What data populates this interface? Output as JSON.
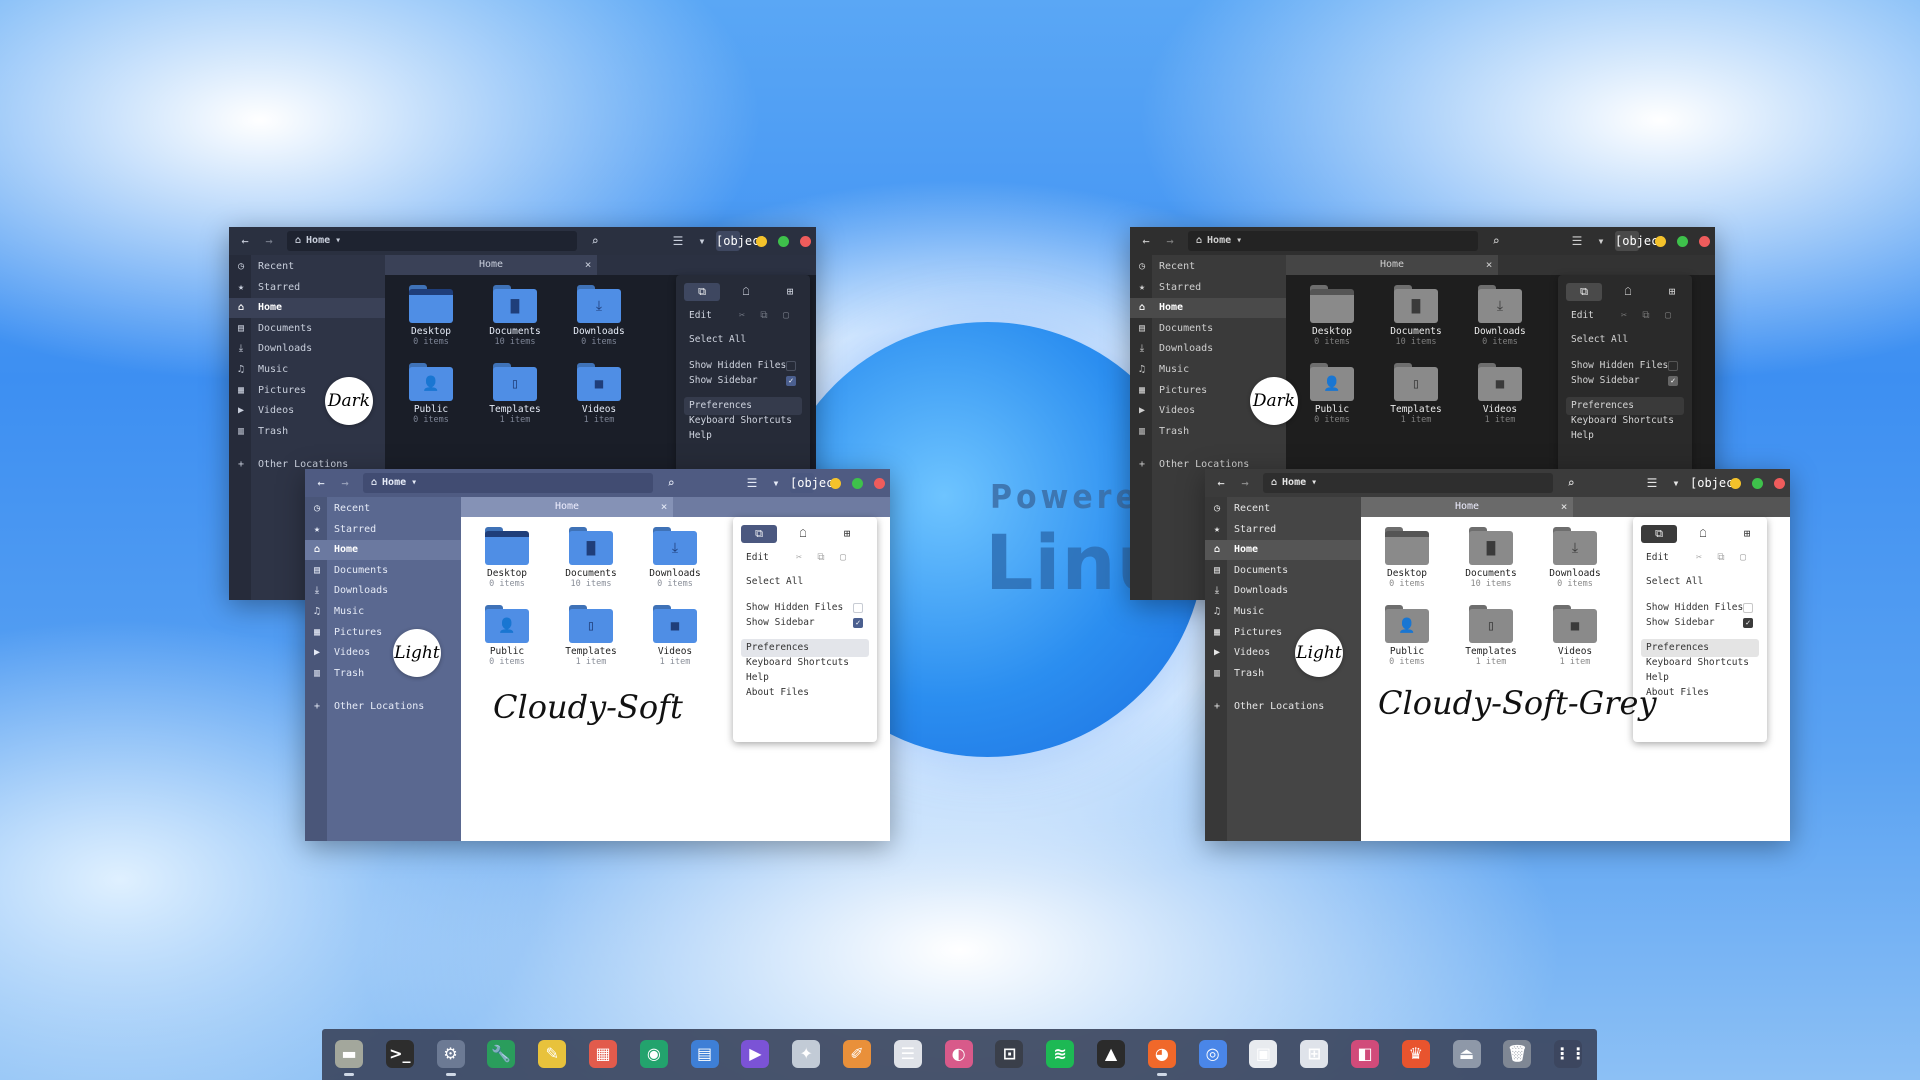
{
  "common": {
    "back": "←",
    "forward": "→",
    "home_icon": "⌂",
    "path": "Home",
    "caret": "▾",
    "search": "⌕",
    "view": "☰",
    "menu": {
      "top_icons": [
        "⧉",
        "☖",
        "⊞"
      ],
      "edit": "Edit",
      "cut": "✂",
      "copy": "⧉",
      "paste": "▢",
      "select_all": "Select All",
      "show_hidden": "Show Hidden Files",
      "show_sidebar": "Show Sidebar",
      "check": "✓",
      "preferences": "Preferences",
      "shortcuts": "Keyboard Shortcuts",
      "help": "Help",
      "about": "About Files"
    },
    "tab": "Home",
    "tab_close": "×",
    "sidebar": {
      "items": [
        "Recent",
        "Starred",
        "Home",
        "Documents",
        "Downloads",
        "Music",
        "Pictures",
        "Videos",
        "Trash"
      ],
      "icons": [
        "◷",
        "★",
        "⌂",
        "▤",
        "⤓",
        "♫",
        "▦",
        "▶",
        "▥"
      ],
      "other": "Other Locations",
      "other_icon": "+"
    },
    "folders": [
      {
        "name": "Desktop",
        "count": "0 items",
        "glyph": ""
      },
      {
        "name": "Documents",
        "count": "10 items",
        "glyph": "▇"
      },
      {
        "name": "Downloads",
        "count": "0 items",
        "glyph": "⤓"
      },
      {
        "name": "Public",
        "count": "0 items",
        "glyph": "👤"
      },
      {
        "name": "Templates",
        "count": "1 item",
        "glyph": "▯"
      },
      {
        "name": "Videos",
        "count": "1 item",
        "glyph": "■"
      }
    ]
  },
  "badges": {
    "dark": "Dark",
    "light": "Light"
  },
  "theme_names": {
    "soft": "Cloudy-Soft",
    "grey": "Cloudy-Soft-Grey"
  },
  "overlay": {
    "powered": "Powered b",
    "linux": "Linux"
  },
  "colors": {
    "soft_dark_bg": "#1f2430",
    "soft_dark_side": "#2b3140",
    "soft_dark_title": "#262c3a",
    "soft_light_side": "#56648a",
    "soft_light_title": "#4b5880",
    "folder_blue": "#4f8ee5",
    "folder_grey": "#8a8a8a",
    "accent": "#4b5f8f"
  },
  "dock": {
    "apps": [
      {
        "name": "files",
        "icon": "▬",
        "bg": "#a3a79c",
        "running": true
      },
      {
        "name": "terminal",
        "icon": ">_",
        "bg": "#2d2d2d",
        "running": false
      },
      {
        "name": "settings",
        "icon": "⚙",
        "bg": "#6c7a94",
        "running": true
      },
      {
        "name": "tweaks",
        "icon": "🔧",
        "bg": "#2a9d5c",
        "running": false
      },
      {
        "name": "notes",
        "icon": "✎",
        "bg": "#e8c23c",
        "running": false
      },
      {
        "name": "calendar",
        "icon": "▦",
        "bg": "#e25b4c",
        "running": false
      },
      {
        "name": "camera",
        "icon": "◉",
        "bg": "#23a36d",
        "running": false
      },
      {
        "name": "writer",
        "icon": "▤",
        "bg": "#3e7fd6",
        "running": false
      },
      {
        "name": "play",
        "icon": "▶",
        "bg": "#7b53d6",
        "running": false
      },
      {
        "name": "store",
        "icon": "✦",
        "bg": "#c2cbd6",
        "running": false
      },
      {
        "name": "picker",
        "icon": "✐",
        "bg": "#e9903a",
        "running": false
      },
      {
        "name": "clipboard",
        "icon": "☰",
        "bg": "#dfe2e8",
        "running": false
      },
      {
        "name": "colors",
        "icon": "◐",
        "bg": "#d85a8a",
        "running": false
      },
      {
        "name": "screenshot",
        "icon": "⊡",
        "bg": "#3a3f4a",
        "running": false
      },
      {
        "name": "spotify",
        "icon": "≋",
        "bg": "#1db954",
        "running": false
      },
      {
        "name": "inkscape",
        "icon": "▲",
        "bg": "#2b2b2b",
        "running": false
      },
      {
        "name": "firefox",
        "icon": "◕",
        "bg": "#f0682a",
        "running": true
      },
      {
        "name": "chromium",
        "icon": "◎",
        "bg": "#4a86e8",
        "running": false
      },
      {
        "name": "document-viewer",
        "icon": "▣",
        "bg": "#e8ebef",
        "running": false
      },
      {
        "name": "calculator",
        "icon": "⊞",
        "bg": "#dfe3ea",
        "running": false
      },
      {
        "name": "image-editor",
        "icon": "◧",
        "bg": "#d14b7a",
        "running": false
      },
      {
        "name": "brave",
        "icon": "♛",
        "bg": "#e8542e",
        "running": false
      },
      {
        "name": "installer",
        "icon": "⏏",
        "bg": "#8e98a8",
        "running": false
      },
      {
        "name": "trash",
        "icon": "🗑",
        "bg": "#7f8794",
        "running": false
      },
      {
        "name": "app-grid",
        "icon": "⋮⋮",
        "bg": "#3c465f",
        "running": false
      }
    ]
  }
}
